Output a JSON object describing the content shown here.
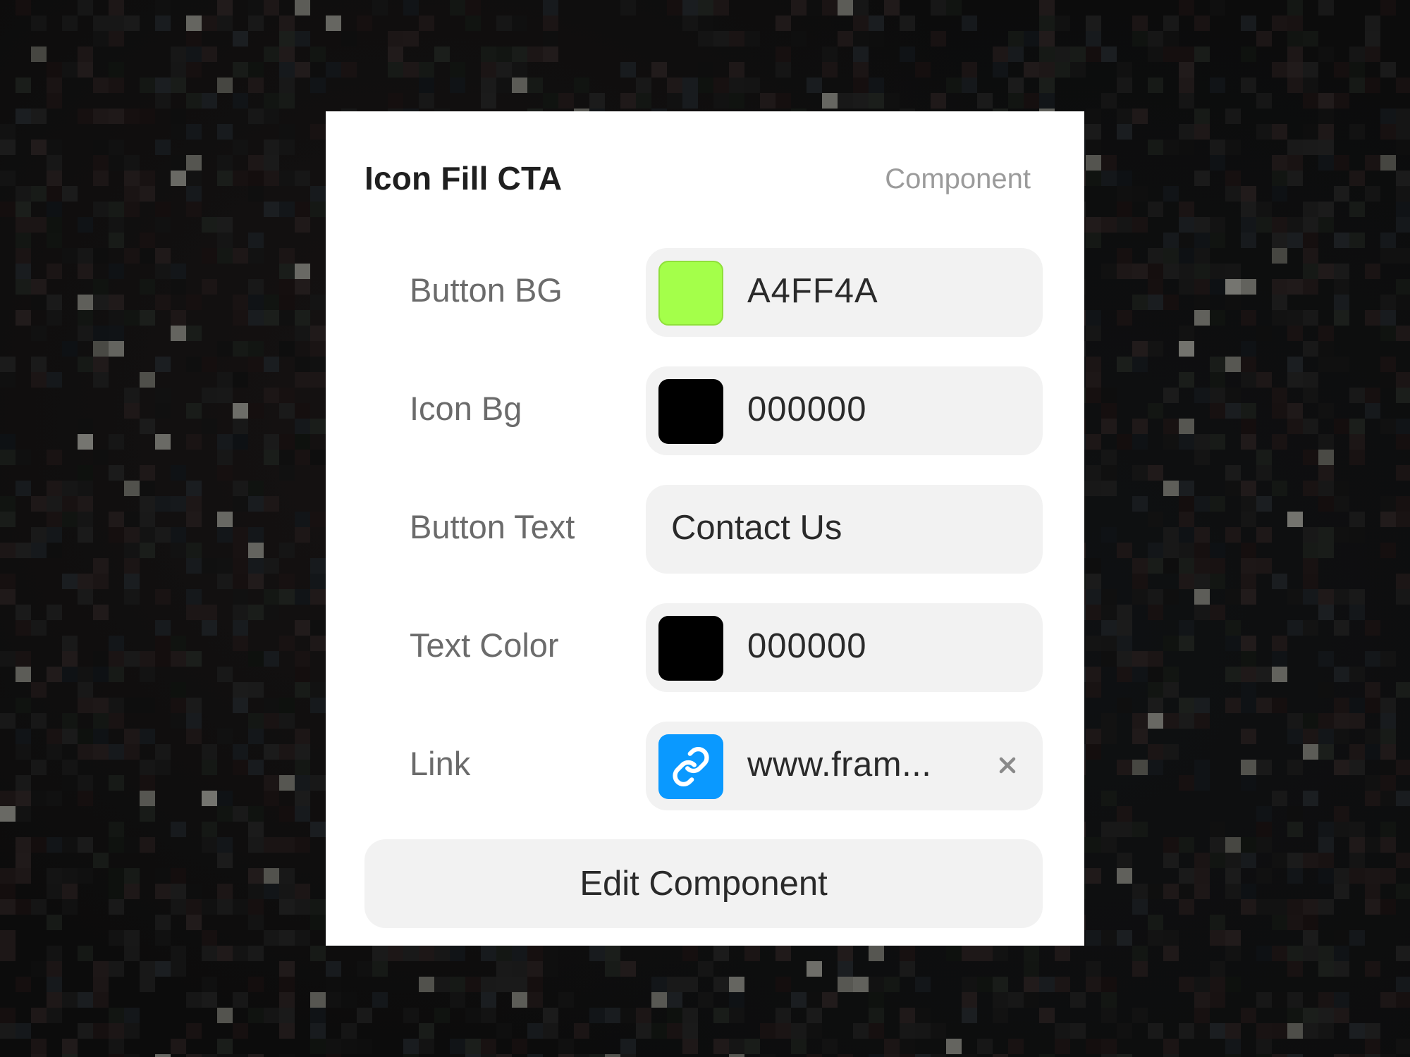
{
  "panel": {
    "title": "Icon Fill CTA",
    "type_label": "Component"
  },
  "properties": [
    {
      "label": "Button BG",
      "kind": "color",
      "value": "A4FF4A",
      "swatch_color": "#A4FF4A"
    },
    {
      "label": "Icon Bg",
      "kind": "color",
      "value": "000000",
      "swatch_color": "#000000"
    },
    {
      "label": "Button Text",
      "kind": "text",
      "value": "Contact Us"
    },
    {
      "label": "Text Color",
      "kind": "color",
      "value": "000000",
      "swatch_color": "#000000"
    },
    {
      "label": "Link",
      "kind": "link",
      "value": "www.fram...",
      "icon": "link-icon",
      "icon_color": "#0A99FF"
    }
  ],
  "actions": {
    "edit_label": "Edit Component"
  }
}
